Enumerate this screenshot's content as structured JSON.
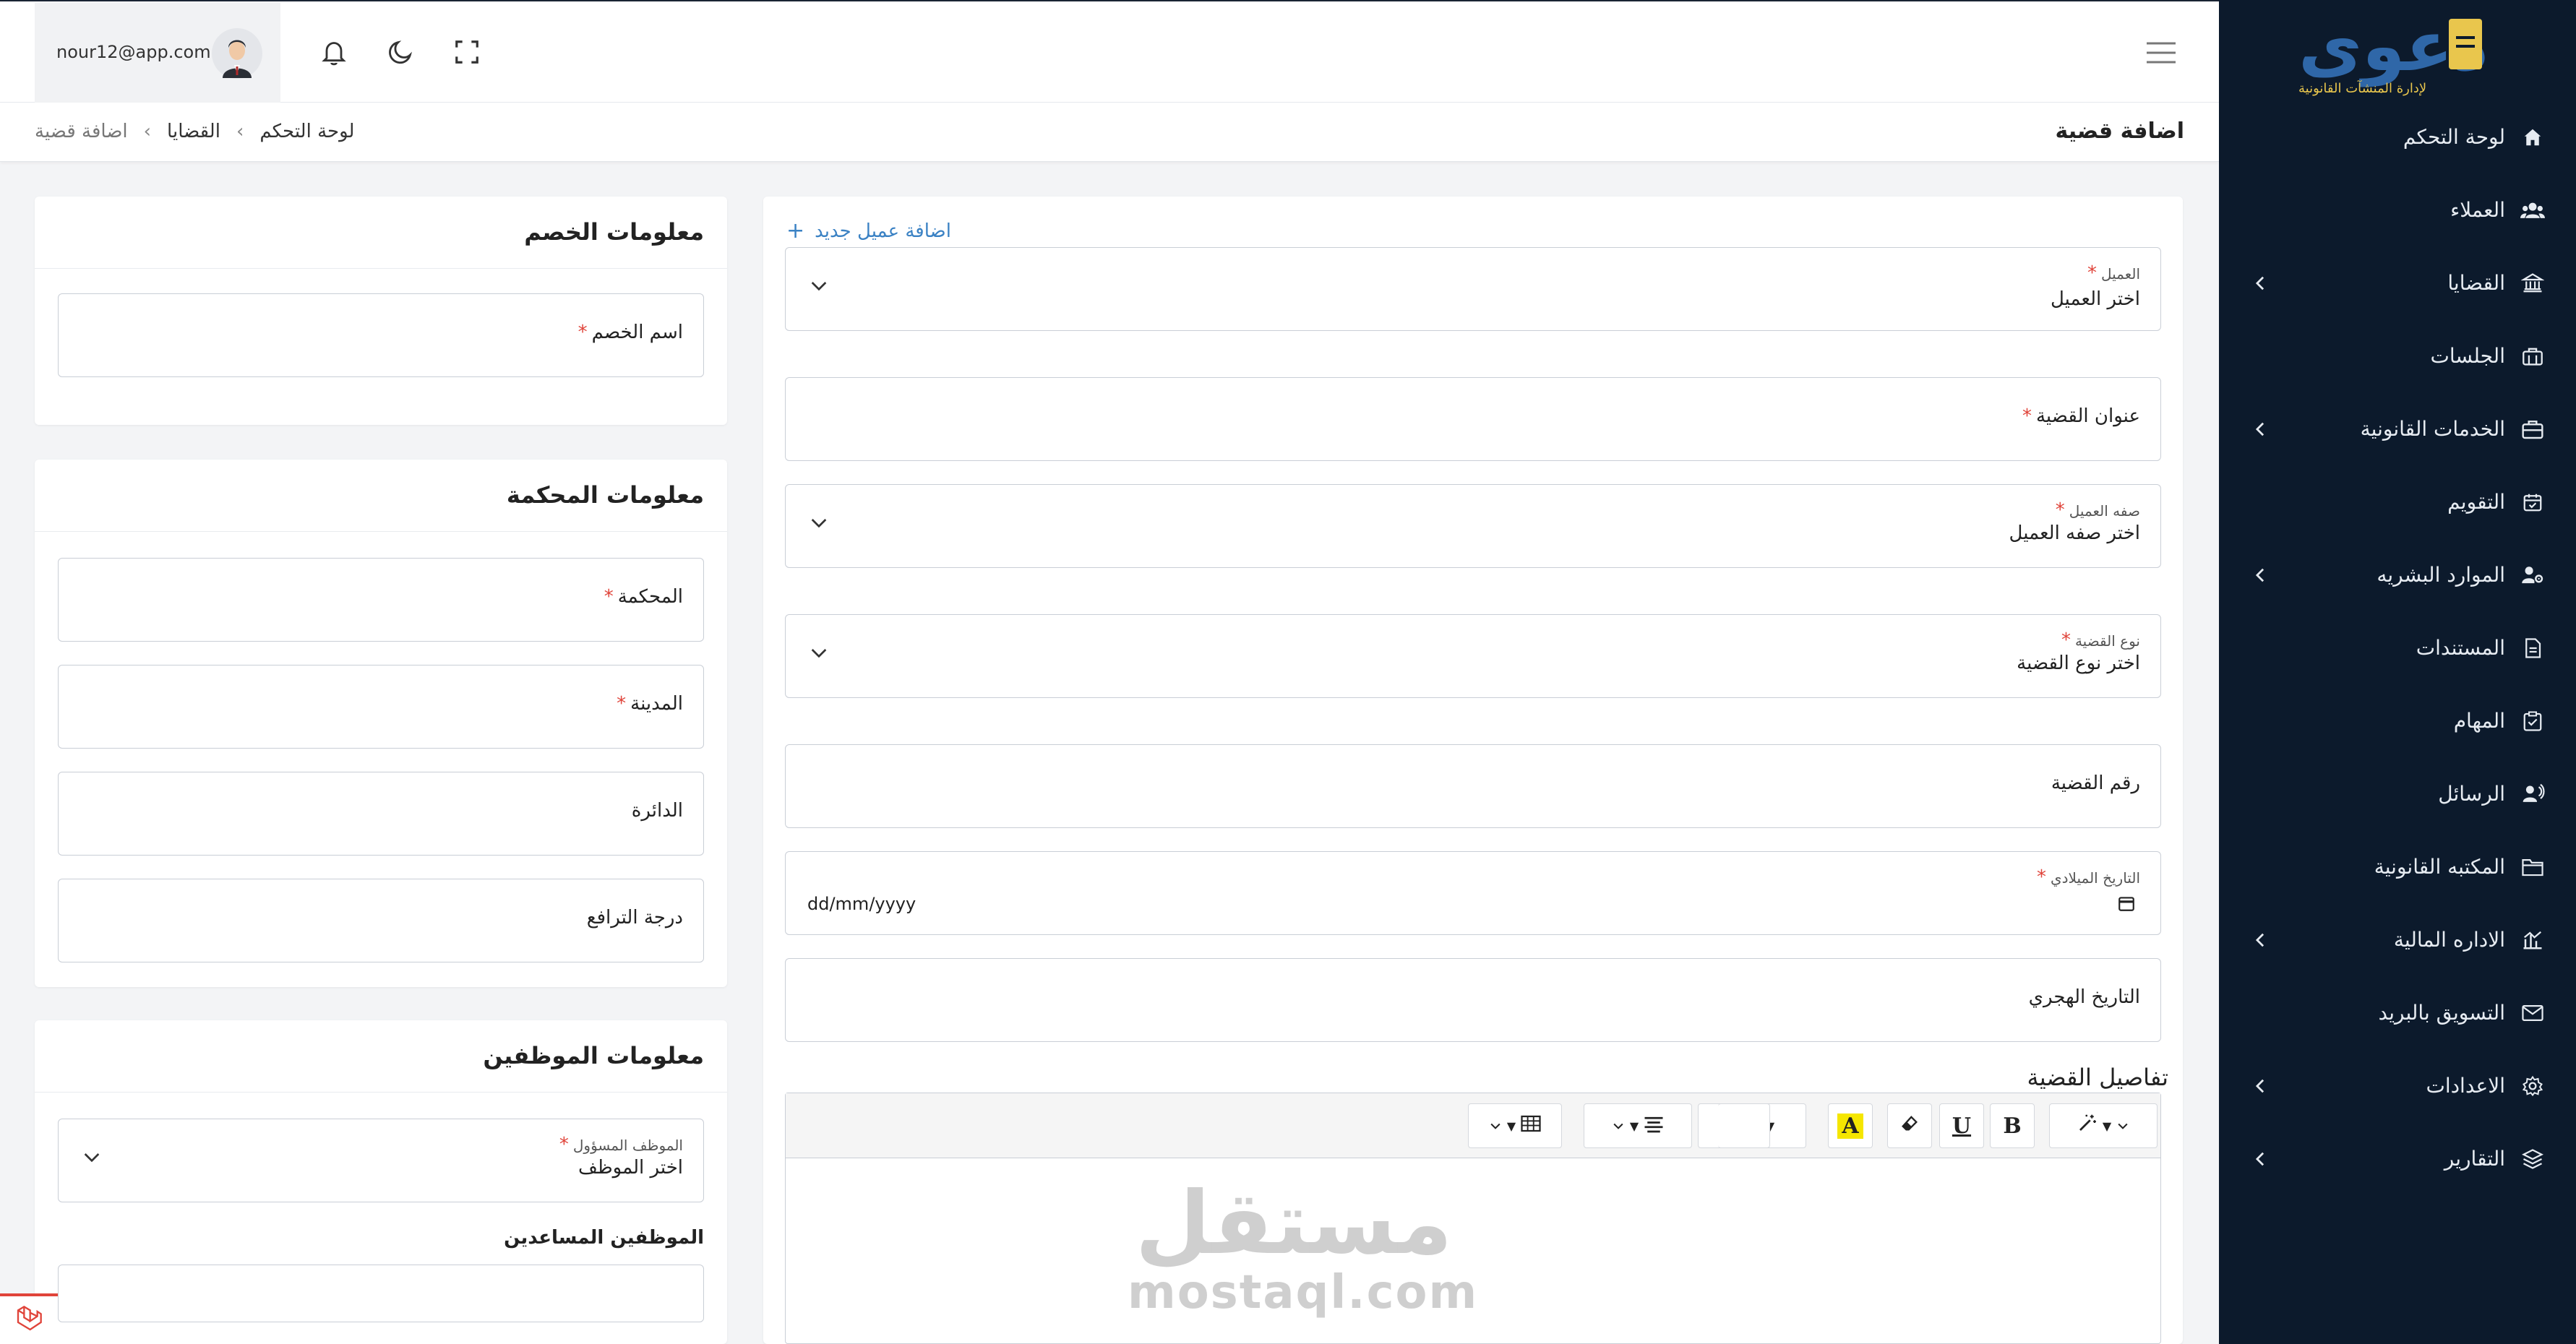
{
  "topbar": {
    "user_email": "nour12@app.com"
  },
  "breadcrumb": {
    "page_title": "اضافة قضية",
    "items": [
      "اضافة قضية",
      "القضايا",
      "لوحة التحكم"
    ]
  },
  "brand": {
    "logo_text": "دعوى",
    "subtitle": "لإدارة المنشآت القانونية",
    "colors": {
      "primary": "#2f67a8",
      "accent": "#e9c64d"
    }
  },
  "sidebar": {
    "items": [
      {
        "label": "لوحة التحكم",
        "icon": "home-icon",
        "has_submenu": false
      },
      {
        "label": "العملاء",
        "icon": "users-icon",
        "has_submenu": false
      },
      {
        "label": "القضايا",
        "icon": "courthouse-icon",
        "has_submenu": true
      },
      {
        "label": "الجلسات",
        "icon": "sessions-icon",
        "has_submenu": false
      },
      {
        "label": "الخدمات القانونية",
        "icon": "briefcase-icon",
        "has_submenu": true
      },
      {
        "label": "التقويم",
        "icon": "calendar-icon",
        "has_submenu": false
      },
      {
        "label": "الموارد البشريه",
        "icon": "user-gear-icon",
        "has_submenu": true
      },
      {
        "label": "المستندات",
        "icon": "document-icon",
        "has_submenu": false
      },
      {
        "label": "المهام",
        "icon": "clipboard-check-icon",
        "has_submenu": false
      },
      {
        "label": "الرسائل",
        "icon": "messages-icon",
        "has_submenu": false
      },
      {
        "label": "المكتبه القانونية",
        "icon": "folder-icon",
        "has_submenu": false
      },
      {
        "label": "الاداره المالية",
        "icon": "finance-chart-icon",
        "has_submenu": true
      },
      {
        "label": "التسويق بالبريد",
        "icon": "mail-icon",
        "has_submenu": false
      },
      {
        "label": "الاعدادات",
        "icon": "gear-icon",
        "has_submenu": true
      },
      {
        "label": "التقارير",
        "icon": "layers-icon",
        "has_submenu": true
      }
    ]
  },
  "case_form": {
    "add_client_link": "اضافة عميل جديد",
    "client_label": "العميل",
    "client_placeholder": "اختر العميل",
    "case_title_label": "عنوان القضية",
    "client_role_label": "صفه العميل",
    "client_role_placeholder": "اختر صفه العميل",
    "case_type_label": "نوع القضية",
    "case_type_placeholder": "اختر نوع القضية",
    "case_number_label": "رقم القضية",
    "gregorian_date_label": "التاريخ الميلادي",
    "gregorian_date_placeholder": "dd/mm/yyyy",
    "hijri_date_label": "التاريخ الهجري",
    "details_heading": "تفاصيل القضية"
  },
  "opponent": {
    "title": "معلومات الخصم",
    "name_label": "اسم الخصم"
  },
  "court": {
    "title": "معلومات المحكمة",
    "court_label": "المحكمة",
    "city_label": "المدينة",
    "circuit_label": "الدائرة",
    "level_label": "درجة الترافع"
  },
  "employees": {
    "title": "معلومات الموظفين",
    "responsible_label": "الموظف المسؤول",
    "responsible_placeholder": "اختر الموظف",
    "assistants_label": "الموظفين المساعدين"
  },
  "required_mark": "*",
  "watermark": {
    "arabic": "مستقل",
    "english": "mostaql.com"
  }
}
